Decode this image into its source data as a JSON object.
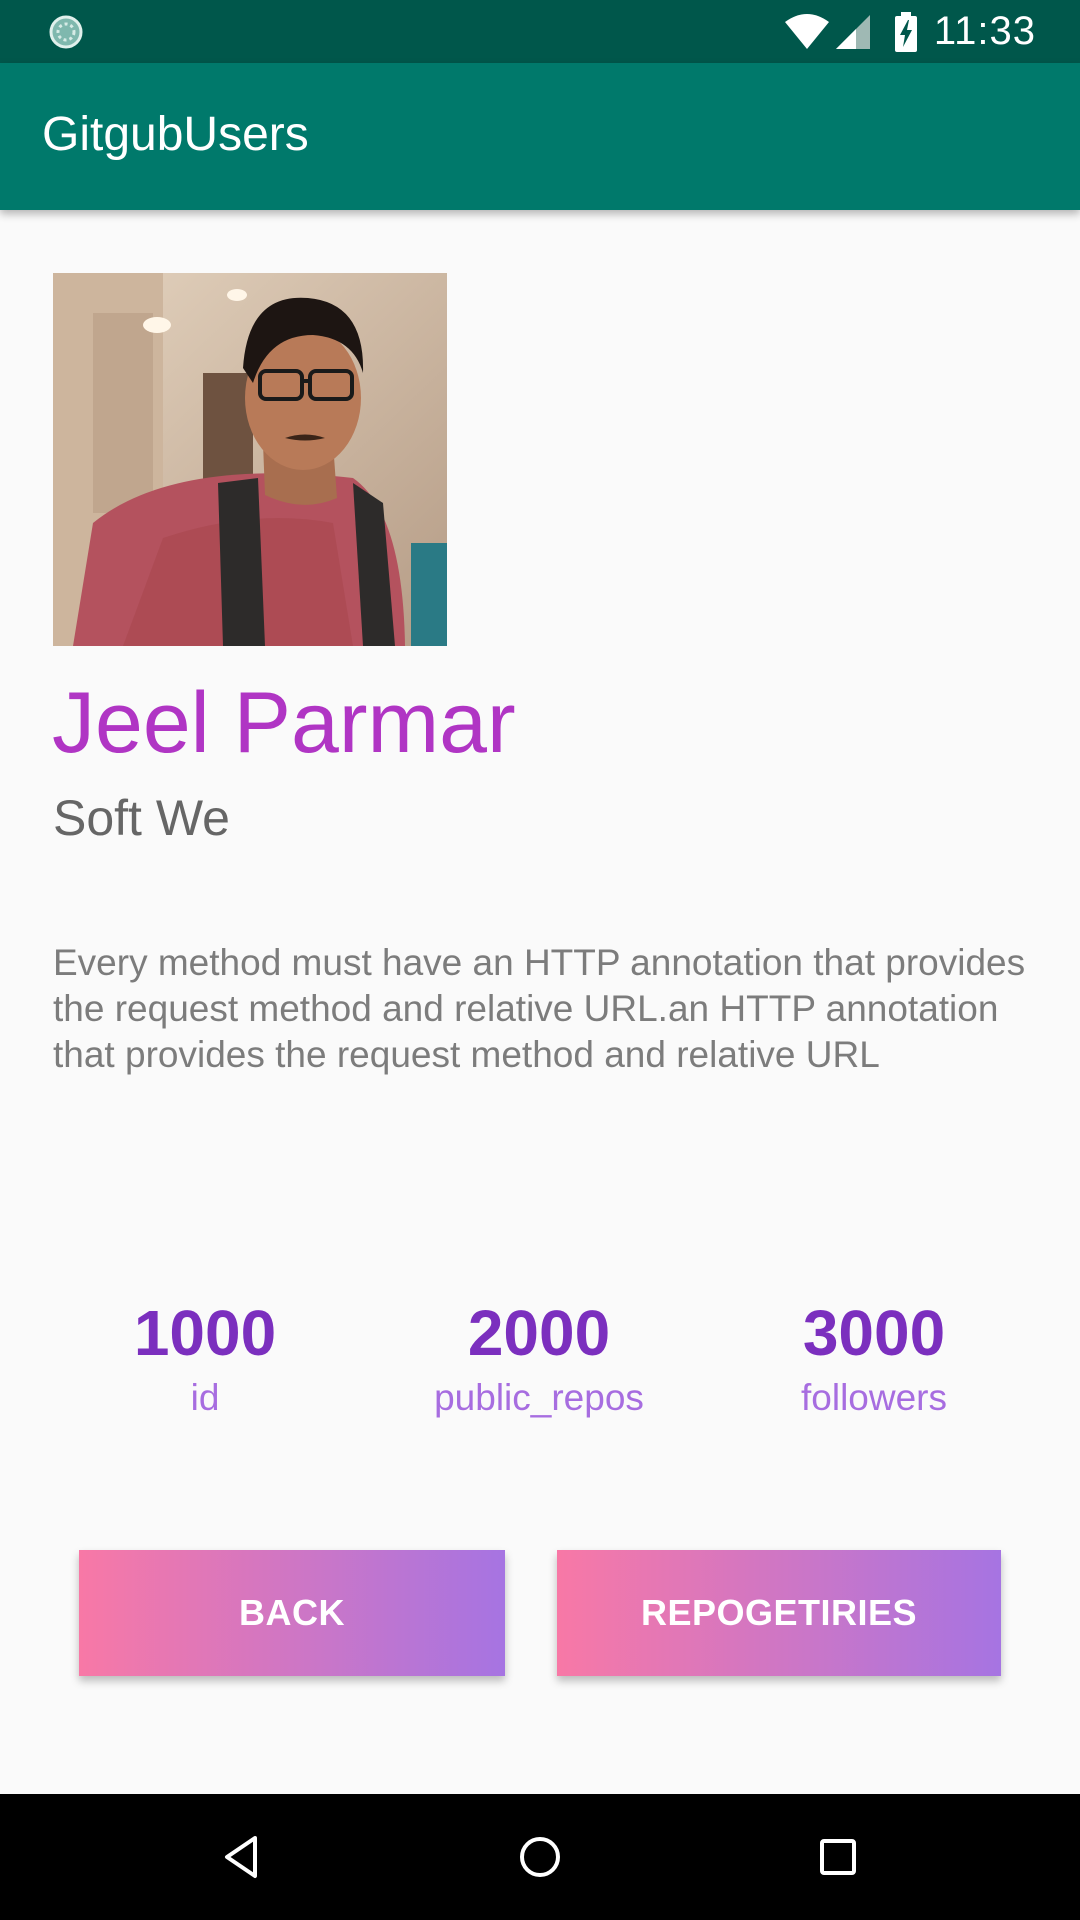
{
  "status_bar": {
    "time": "11:33",
    "icons": [
      "sync-icon",
      "wifi-icon",
      "signal-icon",
      "battery-charging-icon"
    ],
    "background": "#00574b"
  },
  "app_bar": {
    "title": "GitgubUsers",
    "background": "#00796b"
  },
  "profile": {
    "avatar": "profile-photo",
    "name": "Jeel Parmar",
    "company": "Soft We",
    "bio": "Every method must have an HTTP annotation that provides the request method and relative URL.an HTTP annotation that provides the request method and relative URL"
  },
  "stats": [
    {
      "value": "1000",
      "label": "id"
    },
    {
      "value": "2000",
      "label": "public_repos"
    },
    {
      "value": "3000",
      "label": "followers"
    }
  ],
  "buttons": {
    "back": "BACK",
    "repositories": "REPOGETIRIES"
  },
  "nav_bar": {
    "icons": [
      "back-icon",
      "home-icon",
      "recents-icon"
    ]
  },
  "colors": {
    "name": "#b035c4",
    "stat_value": "#7b2fbe",
    "stat_label": "#a76de0",
    "button_gradient_start": "#f878a6",
    "button_gradient_end": "#a674e2"
  }
}
